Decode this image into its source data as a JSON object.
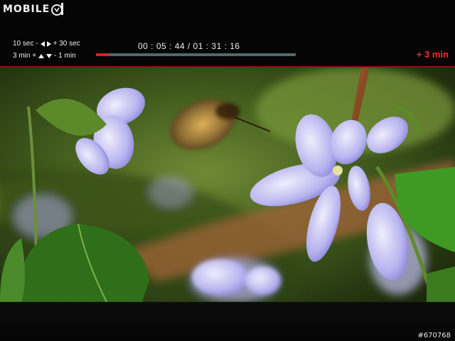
{
  "watermark": {
    "text": "MOBILE",
    "logo_icon": "mobile01-logo-icon"
  },
  "osd": {
    "hint_forward_back": {
      "back_label": "10 sec -",
      "forward_label": "+ 30 sec",
      "icons": [
        "left-triangle-icon",
        "right-triangle-icon"
      ]
    },
    "hint_jump": {
      "forward_label": "3 min +",
      "back_label": "- 1 min",
      "icons": [
        "up-triangle-icon",
        "down-triangle-icon"
      ]
    },
    "timecode": "00 : 05 : 44 / 01 : 31 : 16",
    "progress": {
      "current_seconds": 344,
      "total_seconds": 5476,
      "fraction": 0.0628
    },
    "seek_delta": "+ 3 min",
    "colors": {
      "accent": "#d42424",
      "track": "#4f6a6a",
      "seek_delta": "#ff2a2a"
    }
  },
  "video": {
    "content_icon": "video-frame-bee-and-violets"
  },
  "footer": {
    "image_id": "#670768"
  }
}
